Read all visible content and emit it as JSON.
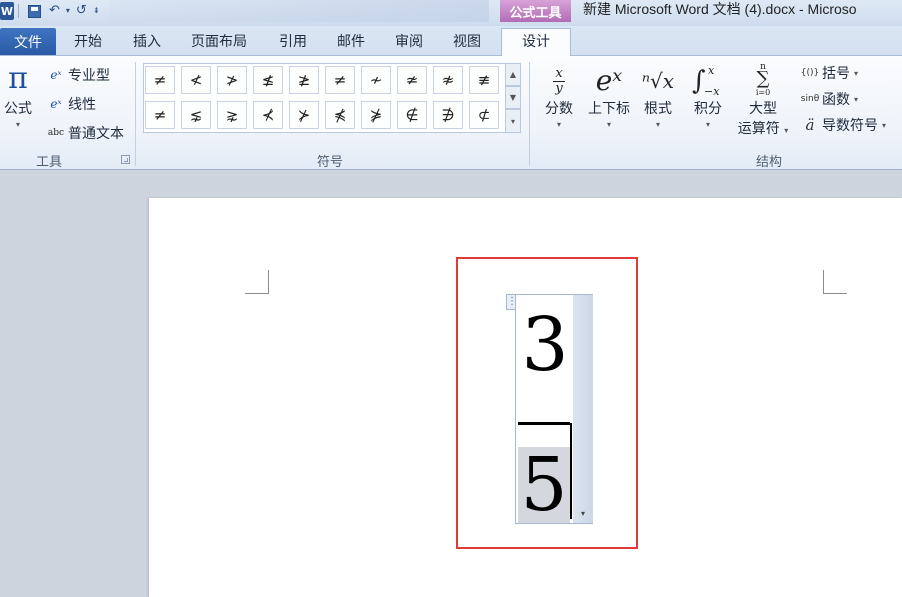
{
  "app": {
    "window_title": "新建 Microsoft Word 文档 (4).docx  -  Microso",
    "context_tab_header": "公式工具",
    "qat": {
      "word_logo_letter": "W",
      "undo_glyph": "↶",
      "redo_glyph": "↺",
      "dropdown_glyph": "▾",
      "customize_glyph": "⇟"
    }
  },
  "tabs": {
    "file": "文件",
    "items": [
      "开始",
      "插入",
      "页面布局",
      "引用",
      "邮件",
      "审阅",
      "视图"
    ],
    "active": "设计"
  },
  "ribbon": {
    "tools": {
      "label": "工具",
      "equation_button": "公式",
      "equation_glyph": "π",
      "professional": "专业型",
      "linear": "线性",
      "normal_text": "普通文本",
      "normal_text_icon": "abc"
    },
    "symbols": {
      "label": "符号",
      "row1": [
        "≠",
        "≮",
        "≯",
        "≰",
        "≱",
        "≠",
        "≁",
        "≄",
        "≉",
        "≢"
      ],
      "row2": [
        "≠",
        "⋦",
        "⋧",
        "⊀",
        "⊁",
        "⋠",
        "⋡",
        "∉",
        "∌",
        "⊄"
      ]
    },
    "structures": {
      "label": "结构",
      "fraction": "分数",
      "fraction_top": "x",
      "fraction_bottom": "y",
      "script": "上下标",
      "script_glyph": "eˣ",
      "radical": "根式",
      "radical_glyph": "ⁿ√x",
      "integral": "积分",
      "integral_glyph": "∫",
      "integral_upper": "x",
      "integral_lower": "−x",
      "large_operator_line1": "大型",
      "large_operator_line2": "运算符",
      "large_operator_glyph": "∑",
      "large_operator_upper": "n",
      "large_operator_lower": "i=0",
      "bracket": "括号",
      "bracket_icon": "{()}",
      "function": "函数",
      "function_icon": "sinθ",
      "accent": "导数符号",
      "accent_icon": "ä"
    }
  },
  "document": {
    "equation": {
      "numerator": "3",
      "denominator": "5",
      "handle_glyph": "⋮",
      "dropdown_glyph": "▾"
    }
  },
  "colors": {
    "file_tab": "#2b5aa6",
    "context_header": "#b26cb5",
    "highlight_box": "#e03b3b"
  }
}
